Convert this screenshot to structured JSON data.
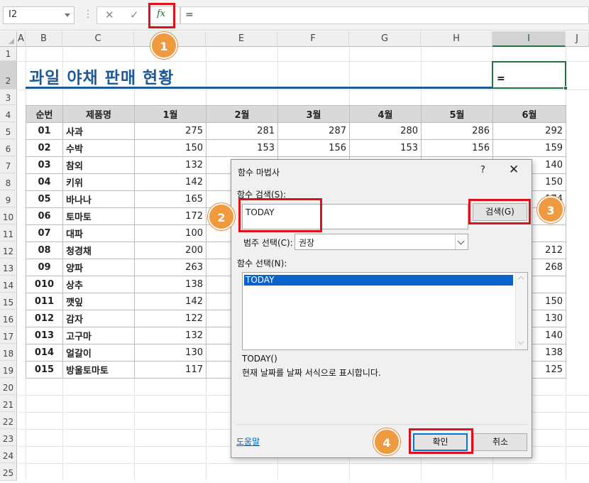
{
  "formula_bar": {
    "name_box": "I2",
    "cancel": "✕",
    "enter": "✓",
    "fx_label": "fx",
    "content": "="
  },
  "columns": [
    "A",
    "B",
    "C",
    "D",
    "E",
    "F",
    "G",
    "H",
    "I",
    "J"
  ],
  "rows": [
    "1",
    "2",
    "3",
    "4",
    "5",
    "6",
    "7",
    "8",
    "9",
    "10",
    "11",
    "12",
    "13",
    "14",
    "15",
    "16",
    "17",
    "18",
    "19",
    "20",
    "21",
    "22",
    "23",
    "24",
    "25"
  ],
  "sheet": {
    "title": "과일 야채 판매 현황",
    "active_cell_value": "=",
    "headers": [
      "순번",
      "제품명",
      "1월",
      "2월",
      "3월",
      "4월",
      "5월",
      "6월"
    ],
    "rows": [
      [
        "01",
        "사과",
        "275",
        "281",
        "287",
        "280",
        "286",
        "292"
      ],
      [
        "02",
        "수박",
        "150",
        "153",
        "156",
        "153",
        "156",
        "159"
      ],
      [
        "03",
        "참외",
        "132",
        "",
        "",
        "",
        "",
        "140"
      ],
      [
        "04",
        "키위",
        "142",
        "",
        "",
        "",
        "",
        "150"
      ],
      [
        "05",
        "바나나",
        "165",
        "",
        "",
        "",
        "",
        "174"
      ],
      [
        "06",
        "토마토",
        "172",
        "",
        "",
        "",
        "",
        ""
      ],
      [
        "07",
        "대파",
        "100",
        "",
        "",
        "",
        "",
        ""
      ],
      [
        "08",
        "청경채",
        "200",
        "",
        "",
        "",
        "",
        "212"
      ],
      [
        "09",
        "양파",
        "263",
        "",
        "",
        "",
        "",
        "268"
      ],
      [
        "010",
        "상추",
        "138",
        "",
        "",
        "",
        "",
        ""
      ],
      [
        "011",
        "깻잎",
        "142",
        "",
        "",
        "",
        "",
        "150"
      ],
      [
        "012",
        "감자",
        "122",
        "",
        "",
        "",
        "",
        "130"
      ],
      [
        "013",
        "고구마",
        "132",
        "",
        "",
        "",
        "",
        "140"
      ],
      [
        "014",
        "얼갈이",
        "130",
        "",
        "",
        "",
        "",
        "138"
      ],
      [
        "015",
        "방울토마토",
        "117",
        "",
        "",
        "",
        "",
        "125"
      ]
    ]
  },
  "dialog": {
    "title": "함수 마법사",
    "help": "?",
    "close": "✕",
    "search_label": "함수 검색(S):",
    "search_value": "TODAY",
    "search_button": "검색(G)",
    "category_label": "범주 선택(C):",
    "category_value": "권장",
    "function_label": "함수 선택(N):",
    "functions": [
      "TODAY"
    ],
    "signature": "TODAY()",
    "description": "현재 날짜를 날짜 서식으로 표시합니다.",
    "help_link": "도움말",
    "ok_button": "확인",
    "cancel_button": "취소"
  },
  "callouts": [
    "1",
    "2",
    "3",
    "4"
  ]
}
